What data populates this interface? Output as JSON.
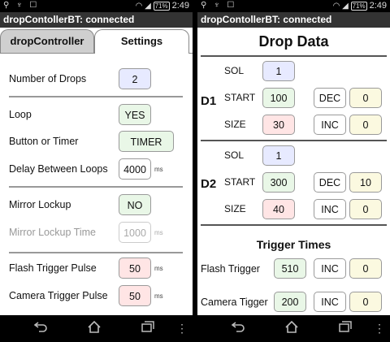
{
  "status": {
    "icons": "⚲ ♆ ☐",
    "battery": "71%",
    "time": "2:49"
  },
  "left": {
    "title": "dropContollerBT: connected",
    "tabs": [
      "dropController",
      "Settings"
    ],
    "settings": [
      {
        "label": "Number of Drops",
        "value": "2",
        "unit": ""
      },
      {
        "label": "Loop",
        "value": "YES",
        "unit": ""
      },
      {
        "label": "Button or Timer",
        "value": "TIMER",
        "unit": ""
      },
      {
        "label": "Delay Between Loops",
        "value": "4000",
        "unit": "ms"
      },
      {
        "label": "Mirror Lockup",
        "value": "NO",
        "unit": ""
      },
      {
        "label": "Mirror Lockup Time",
        "value": "1000",
        "unit": "ms"
      },
      {
        "label": "Flash Trigger Pulse",
        "value": "50",
        "unit": "ms"
      },
      {
        "label": "Camera Trigger Pulse",
        "value": "50",
        "unit": "ms"
      }
    ]
  },
  "right": {
    "title": "dropContollerBT: connected",
    "heading": "Drop Data",
    "drops": [
      {
        "name": "D1",
        "sol_label": "SOL",
        "sol": "1",
        "start_label": "START",
        "start": "100",
        "size_label": "SIZE",
        "size": "30",
        "dec_label": "DEC",
        "dec": "0",
        "inc_label": "INC",
        "inc": "0"
      },
      {
        "name": "D2",
        "sol_label": "SOL",
        "sol": "1",
        "start_label": "START",
        "start": "300",
        "size_label": "SIZE",
        "size": "40",
        "dec_label": "DEC",
        "dec": "10",
        "inc_label": "INC",
        "inc": "0"
      }
    ],
    "trigger_heading": "Trigger Times",
    "triggers": [
      {
        "label": "Flash Trigger",
        "value": "510",
        "inc_label": "INC",
        "inc": "0"
      },
      {
        "label": "Camera Tigger",
        "value": "200",
        "inc_label": "INC",
        "inc": "0"
      }
    ]
  }
}
